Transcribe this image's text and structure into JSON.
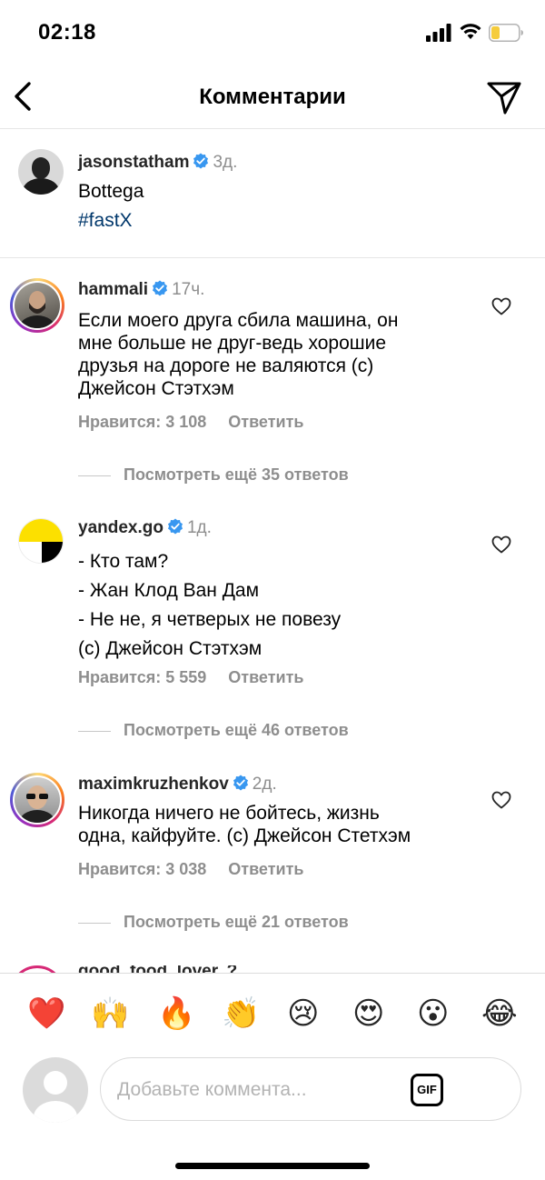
{
  "status": {
    "time": "02:18"
  },
  "header": {
    "title": "Комментарии"
  },
  "caption": {
    "username": "jasonstatham",
    "time": "3д.",
    "line1": "Bottega",
    "hashtag": "#fastX"
  },
  "comments": [
    {
      "username": "hammali",
      "time": "17ч.",
      "lines": [
        "Если моего друга сбила машина, он",
        "мне больше не друг-ведь хорошие",
        "друзья на дороге не валяются (с)",
        "Джейсон Стэтхэм"
      ],
      "likes": "Нравится: 3 108",
      "reply": "Ответить",
      "view_replies": "Посмотреть ещё 35 ответов"
    },
    {
      "username": "yandex.go",
      "time": "1д.",
      "lines": [
        "- Кто там?",
        "- Жан Клод Ван Дам",
        "- Не не, я четверых не повезу",
        "(с) Джейсон Стэтхэм"
      ],
      "likes": "Нравится: 5 559",
      "reply": "Ответить",
      "view_replies": "Посмотреть ещё 46 ответов"
    },
    {
      "username": "maximkruzhenkov",
      "time": "2д.",
      "lines": [
        "Никогда ничего не бойтесь, жизнь",
        "одна, кайфуйте. (с) Джейсон Стетхэм"
      ],
      "likes": "Нравится: 3 038",
      "reply": "Ответить",
      "view_replies": "Посмотреть ещё 21 ответов"
    }
  ],
  "next_comment_partial": "good_food_lover..?",
  "emojis": [
    "❤️",
    "🙌",
    "🔥",
    "👏",
    "😢",
    "😍",
    "😮",
    "😂"
  ],
  "composer": {
    "placeholder": "Добавьте коммента...",
    "gif_label": "GIF"
  },
  "colors": {
    "link": "#00376b",
    "verified": "#3897f0",
    "secondary_text": "#8e8e8e"
  }
}
